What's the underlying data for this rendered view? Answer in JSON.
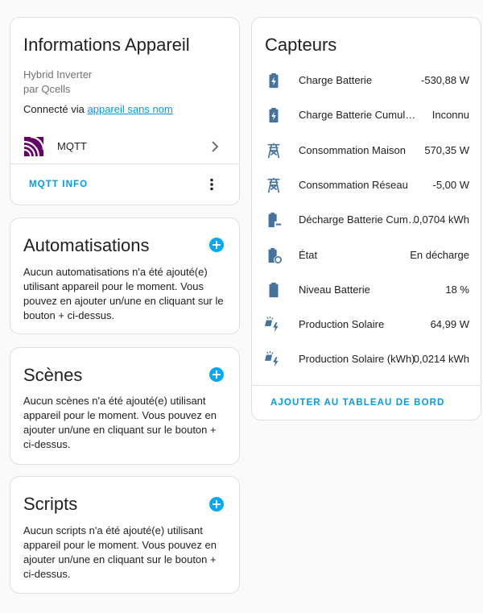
{
  "device_info": {
    "title": "Informations Appareil",
    "model": "Hybrid Inverter",
    "manufacturer": "par Qcells",
    "connected_prefix": "Connecté via",
    "connected_link": "appareil sans nom",
    "integration_name": "MQTT",
    "integration_icon": "mqtt-icon",
    "action_label": "MQTT INFO"
  },
  "automations": {
    "title": "Automatisations",
    "text": "Aucun automatisations n'a été ajouté(e) utilisant appareil pour le moment. Vous pouvez en ajouter un/une en cliquant sur le bouton + ci-dessus."
  },
  "scenes": {
    "title": "Scènes",
    "text": "Aucun scènes n'a été ajouté(e) utilisant appareil pour le moment. Vous pouvez en ajouter un/une en cliquant sur le bouton + ci-dessus."
  },
  "scripts": {
    "title": "Scripts",
    "text": "Aucun scripts n'a été ajouté(e) utilisant appareil pour le moment. Vous pouvez en ajouter un/une en cliquant sur le bouton + ci-dessus."
  },
  "sensors": {
    "title": "Capteurs",
    "items": [
      {
        "name": "Charge Batterie",
        "value": "-530,88 W",
        "icon": "battery-charging-icon"
      },
      {
        "name": "Charge Batterie Cumulée (kWh)",
        "value": "Inconnu",
        "icon": "battery-charging-icon"
      },
      {
        "name": "Consommation Maison",
        "value": "570,35 W",
        "icon": "transmission-tower-icon"
      },
      {
        "name": "Consommation Réseau",
        "value": "-5,00 W",
        "icon": "transmission-tower-icon"
      },
      {
        "name": "Décharge Batterie Cumulée",
        "value": "0,0704 kWh",
        "icon": "battery-minus-icon"
      },
      {
        "name": "État",
        "value": "En décharge",
        "icon": "battery-sync-icon"
      },
      {
        "name": "Niveau Batterie",
        "value": "18 %",
        "icon": "battery-icon"
      },
      {
        "name": "Production Solaire",
        "value": "64,99 W",
        "icon": "solar-power-icon"
      },
      {
        "name": "Production Solaire (kWh)",
        "value": "0,0214 kWh",
        "icon": "solar-power-icon"
      }
    ],
    "action_label": "AJOUTER AU TABLEAU DE BORD"
  },
  "colors": {
    "accent": "#03a9f4",
    "link": "#039be5",
    "icon": "#44739e",
    "mqtt": "#660066"
  }
}
